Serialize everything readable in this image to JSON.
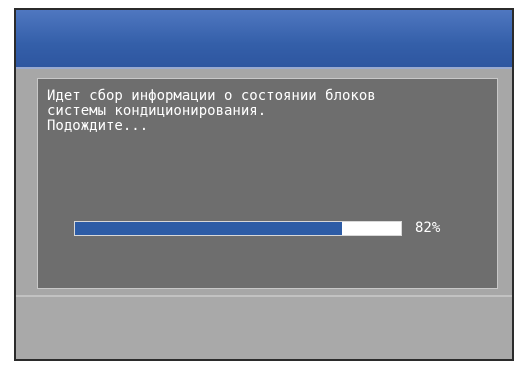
{
  "dialog": {
    "message_line1": "Идет сбор информации о состоянии блоков",
    "message_line2": "системы кондиционирования.",
    "message_line3": "Подождите..."
  },
  "progress": {
    "value_percent": 82,
    "label": "82%",
    "fill_color": "#2d5ca6"
  },
  "colors": {
    "header": "#345fa9",
    "panel": "#6e6e6e",
    "background": "#a8a8a8"
  }
}
